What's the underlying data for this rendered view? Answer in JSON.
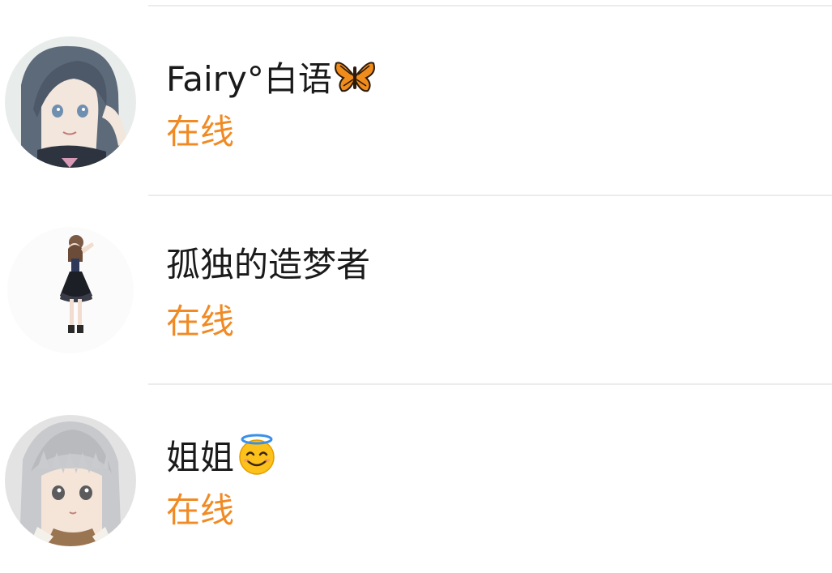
{
  "contacts": [
    {
      "name": "Fairy°白语",
      "name_emoji": "butterfly-icon",
      "status": "在线",
      "avatar": "anime-girl-dark-hair-avatar"
    },
    {
      "name": "孤独的造梦者",
      "name_emoji": "",
      "status": "在线",
      "avatar": "standing-figure-black-dress-avatar"
    },
    {
      "name": "姐姐",
      "name_emoji": "smiling-face-with-halo-icon",
      "status": "在线",
      "avatar": "anime-girl-silver-hair-avatar"
    }
  ],
  "colors": {
    "status_online": "#f08a24",
    "name_text": "#1a1a1a",
    "divider": "#ececec"
  }
}
